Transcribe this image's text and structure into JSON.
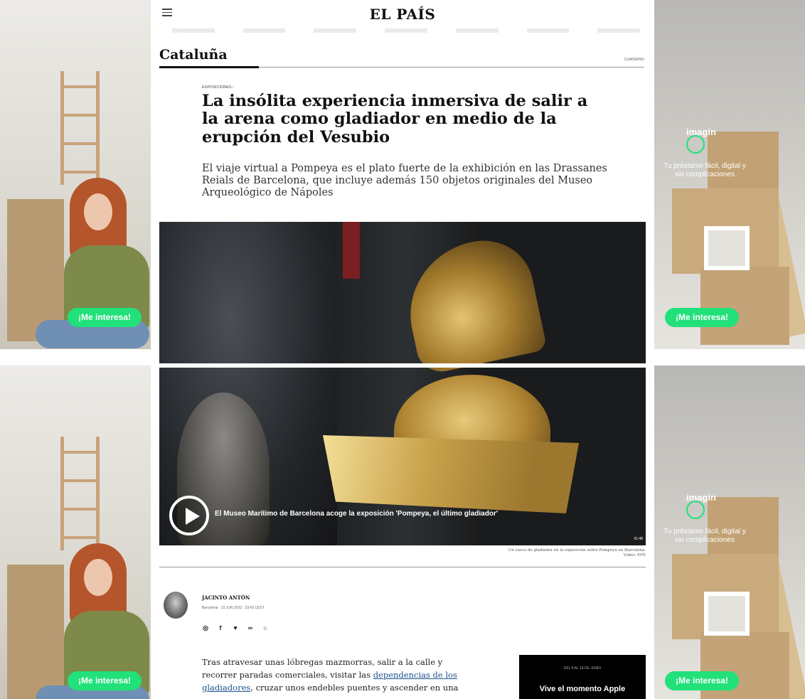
{
  "header": {
    "logo": "EL PAÍS",
    "menu_icon": "hamburger-menu-icon"
  },
  "section": {
    "title": "Cataluña",
    "link": "CUADERNO"
  },
  "article": {
    "kicker": "EXPOSICIONES ›",
    "headline": "La insólita experiencia inmersiva de salir a la arena como gladiador en medio de la erupción del Vesubio",
    "deck": "El viaje virtual a Pompeya es el plato fuerte de la exhibición en las Drassanes Reials de Barcelona, que incluye además 150 objetos originales del Museo Arqueológico de Nápoles"
  },
  "video": {
    "title": "El Museo Marítimo de Barcelona acoge la exposición 'Pompeya, el último gladiador'",
    "duration": "01:48",
    "caption_line1": "Un casco de gladiador en la exposición sobre Pompeya en Barcelona.",
    "caption_line2": "Vídeo: EFE"
  },
  "byline": {
    "author": "JACINTO ANTÓN",
    "dateline": "Barcelona · 31 JUN 2023 · 23:43 CEST",
    "share_icons": [
      "whatsapp-icon",
      "facebook-icon",
      "twitter-icon",
      "link-icon",
      "comment-icon"
    ]
  },
  "body": {
    "p1_a": "Tras atravesar unas lóbregas mazmorras, salir a la calle y recorrer paradas comerciales, visitar las ",
    "p1_link": "dependencias de los gladiadores",
    "p1_b": ", cruzar unos endebles puentes y ascender en una"
  },
  "promo": {
    "kicker": "DEL 8 AL 18 DE JUNIO",
    "title": "Vive el momento Apple"
  },
  "ads": {
    "cta": "¡Me interesa!",
    "brand": "imagin",
    "tagline": "Tu préstamo fácil, digital y sin complicaciones"
  },
  "colors": {
    "cta_green": "#22e07a",
    "link_blue": "#1a4f8a",
    "promo_bg": "#000000"
  }
}
